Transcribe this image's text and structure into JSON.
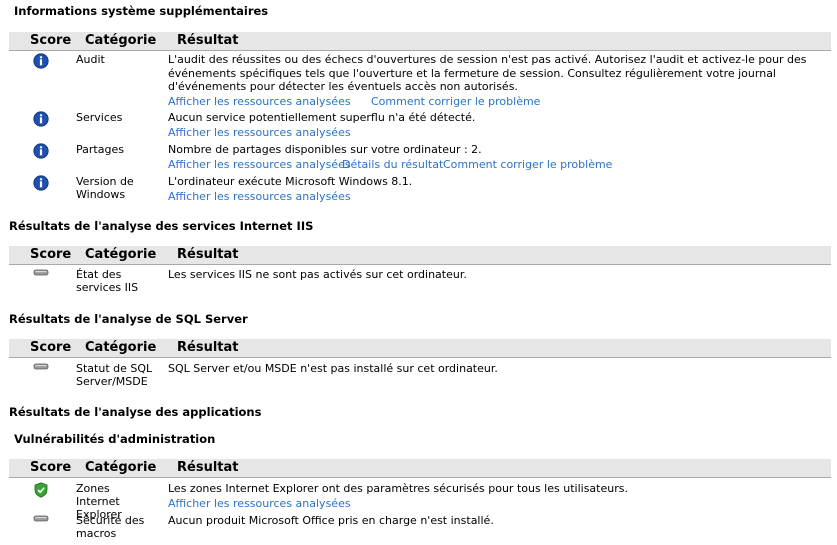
{
  "labels": {
    "link_resources": "Afficher les ressources analysées",
    "link_fix": "Comment corriger le problème",
    "link_details": "Détails du résultat"
  },
  "sections": [
    {
      "title": "Informations système supplémentaires",
      "headers": {
        "score": "Score",
        "category": "Catégorie",
        "result": "Résultat"
      },
      "rows": [
        {
          "icon": "info-icon",
          "category": "Audit",
          "result": "L'audit des réussites ou des échecs d'ouvertures de session n'est pas activé. Autorisez l'audit et activez-le pour des événements spécifiques tels que l'ouverture et la fermeture de session. Consultez régulièrement votre journal d'événements pour détecter les éventuels accès non autorisés."
        },
        {
          "icon": "info-icon",
          "category": "Services",
          "result": "Aucun service potentiellement superflu n'a été détecté."
        },
        {
          "icon": "info-icon",
          "category": "Partages",
          "result": "Nombre de partages disponibles sur votre ordinateur : 2."
        },
        {
          "icon": "info-icon",
          "category": "Version de Windows",
          "result": "L'ordinateur exécute Microsoft Windows 8.1."
        }
      ]
    },
    {
      "title": "Résultats de l'analyse des services Internet IIS",
      "headers": {
        "score": "Score",
        "category": "Catégorie",
        "result": "Résultat"
      },
      "rows": [
        {
          "icon": "not-applicable-icon",
          "category": "État des services IIS",
          "result": "Les services IIS ne sont pas activés sur cet ordinateur."
        }
      ]
    },
    {
      "title": "Résultats de l'analyse de SQL Server",
      "headers": {
        "score": "Score",
        "category": "Catégorie",
        "result": "Résultat"
      },
      "rows": [
        {
          "icon": "not-applicable-icon",
          "category": "Statut de SQL Server/MSDE",
          "result": "SQL Server et/ou MSDE n'est pas installé sur cet ordinateur."
        }
      ]
    },
    {
      "title": "Résultats de l'analyse des applications",
      "subtitle": "Vulnérabilités d'administration",
      "headers": {
        "score": "Score",
        "category": "Catégorie",
        "result": "Résultat"
      },
      "rows": [
        {
          "icon": "pass-shield-icon",
          "category": "Zones Internet Explorer",
          "result": "Les zones Internet Explorer ont des paramètres sécurisés pour tous les utilisateurs."
        },
        {
          "icon": "not-applicable-icon",
          "category": "Sécurité des macros",
          "result": "Aucun produit Microsoft Office pris en charge n'est installé."
        }
      ]
    }
  ],
  "colors": {
    "link": "#2a73c7",
    "info_icon": "#1f4fb0",
    "pass_icon": "#3aa335",
    "header_bg": "#e6e6e6"
  }
}
